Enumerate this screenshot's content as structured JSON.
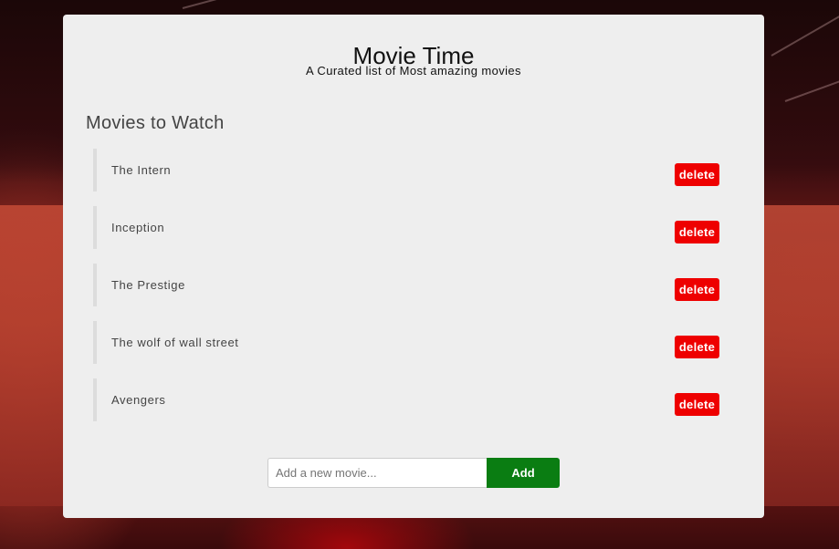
{
  "app": {
    "title": "Movie Time",
    "subtitle": "A Curated list of Most amazing movies"
  },
  "list": {
    "heading": "Movies to Watch",
    "items": [
      {
        "name": "The Intern",
        "delete_label": "delete"
      },
      {
        "name": "Inception",
        "delete_label": "delete"
      },
      {
        "name": "The Prestige",
        "delete_label": "delete"
      },
      {
        "name": "The wolf of wall street",
        "delete_label": "delete"
      },
      {
        "name": "Avengers",
        "delete_label": "delete"
      }
    ]
  },
  "form": {
    "input_value": "",
    "input_placeholder": "Add a new movie...",
    "add_label": "Add"
  },
  "colors": {
    "delete": "#ee0000",
    "add": "#0a7d12",
    "card": "#eeeeee"
  }
}
